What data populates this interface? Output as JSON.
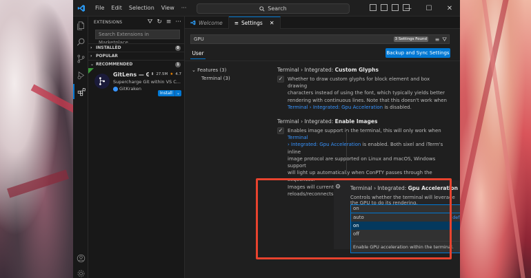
{
  "titlebar": {
    "menu": [
      "File",
      "Edit",
      "Selection",
      "View"
    ],
    "search_label": "Search",
    "back_icon": "arrow-left-icon",
    "forward_icon": "arrow-right-icon"
  },
  "activity_bar": {
    "items": [
      "files-icon",
      "search-icon",
      "source-control-icon",
      "run-debug-icon",
      "extensions-icon"
    ],
    "bottom": [
      "account-icon",
      "manage-gear-icon"
    ],
    "extensions_badge": ""
  },
  "sidebar": {
    "title": "EXTENSIONS",
    "search_placeholder": "Search Extensions in Marketplace",
    "sections": {
      "installed": {
        "label": "INSTALLED",
        "count": "0"
      },
      "popular": {
        "label": "POPULAR"
      },
      "recommended": {
        "label": "RECOMMENDED",
        "count": "1"
      }
    },
    "extension": {
      "name": "GitLens — Gi...",
      "downloads": "27.5M",
      "rating": "4.7",
      "description": "Supercharge Git within VS C...",
      "publisher": "GitKraken",
      "install_label": "Install"
    }
  },
  "editor": {
    "tabs": [
      {
        "label": "Welcome",
        "active": false
      },
      {
        "label": "Settings",
        "active": true
      }
    ],
    "settings_search": "GPU",
    "found_badge": "3 Settings Found",
    "user_tab": "User",
    "sync_button": "Backup and Sync Settings",
    "toc": {
      "features": "Features (3)",
      "terminal": "Terminal (3)"
    },
    "settings": {
      "glyphs": {
        "category": "Terminal › Integrated: ",
        "name": "Custom Glyphs",
        "desc_l1": "Whether to draw custom glyphs for block element and box drawing",
        "desc_l2": "characters instead of using the font, which typically yields better",
        "desc_l3": "rendering with continuous lines. Note that this doesn't work when",
        "desc_link": "Terminal › Integrated: Gpu Acceleration",
        "desc_tail": " is disabled."
      },
      "images": {
        "category": "Terminal › Integrated: ",
        "name": "Enable Images",
        "desc_l1a": "Enables image support in the terminal, this will only work when ",
        "desc_link1": "Terminal",
        "desc_link2": "› Integrated: Gpu Acceleration",
        "desc_l2b": " is enabled. Both sixel and iTerm's inline",
        "desc_l3": "image protocol are supported on Linux and macOS, Windows support",
        "desc_l4": "will light up automatically when ConPTY passes through the sequences.",
        "desc_l5": "Images will currently not be restored between window",
        "desc_l6": "reloads/reconnects."
      },
      "gpu": {
        "category": "Terminal › Integrated: ",
        "name": "Gpu Acceleration",
        "description": "Controls whether the terminal will leverage the GPU to do its rendering.",
        "value": "on",
        "options": [
          {
            "label": "auto",
            "note": "default"
          },
          {
            "label": "on",
            "note": ""
          },
          {
            "label": "off",
            "note": ""
          }
        ],
        "selected_option": "on",
        "option_description": "Enable GPU acceleration within the terminal."
      }
    }
  },
  "colors": {
    "accent": "#0078d4",
    "link": "#3794ff",
    "highlight": "#e8432e"
  }
}
